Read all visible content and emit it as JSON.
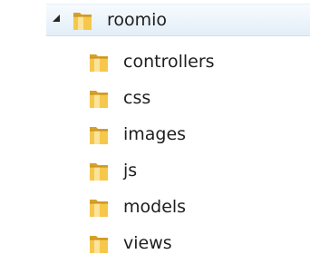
{
  "tree": {
    "root": {
      "label": "roomio",
      "icon": "folder-icon",
      "expanded": true,
      "selected": true
    },
    "children": [
      {
        "label": "controllers",
        "icon": "folder-icon"
      },
      {
        "label": "css",
        "icon": "folder-icon"
      },
      {
        "label": "images",
        "icon": "folder-icon"
      },
      {
        "label": "js",
        "icon": "folder-icon"
      },
      {
        "label": "models",
        "icon": "folder-icon"
      },
      {
        "label": "views",
        "icon": "folder-icon"
      }
    ]
  },
  "colors": {
    "selection_top": "#f7fbfe",
    "selection_bottom": "#e3eef8",
    "folder_yellow": "#f5c84c",
    "folder_dark": "#d8a028",
    "text": "#1e1e1e"
  }
}
